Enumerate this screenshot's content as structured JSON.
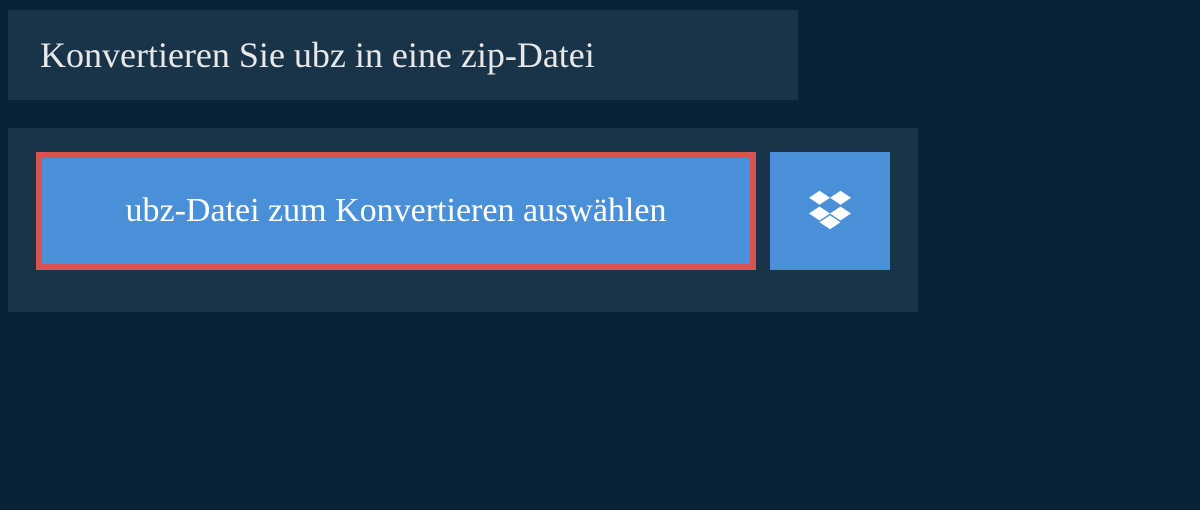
{
  "header": {
    "title": "Konvertieren Sie ubz in eine zip-Datei"
  },
  "upload": {
    "select_label": "ubz-Datei zum Konvertieren auswählen"
  }
}
